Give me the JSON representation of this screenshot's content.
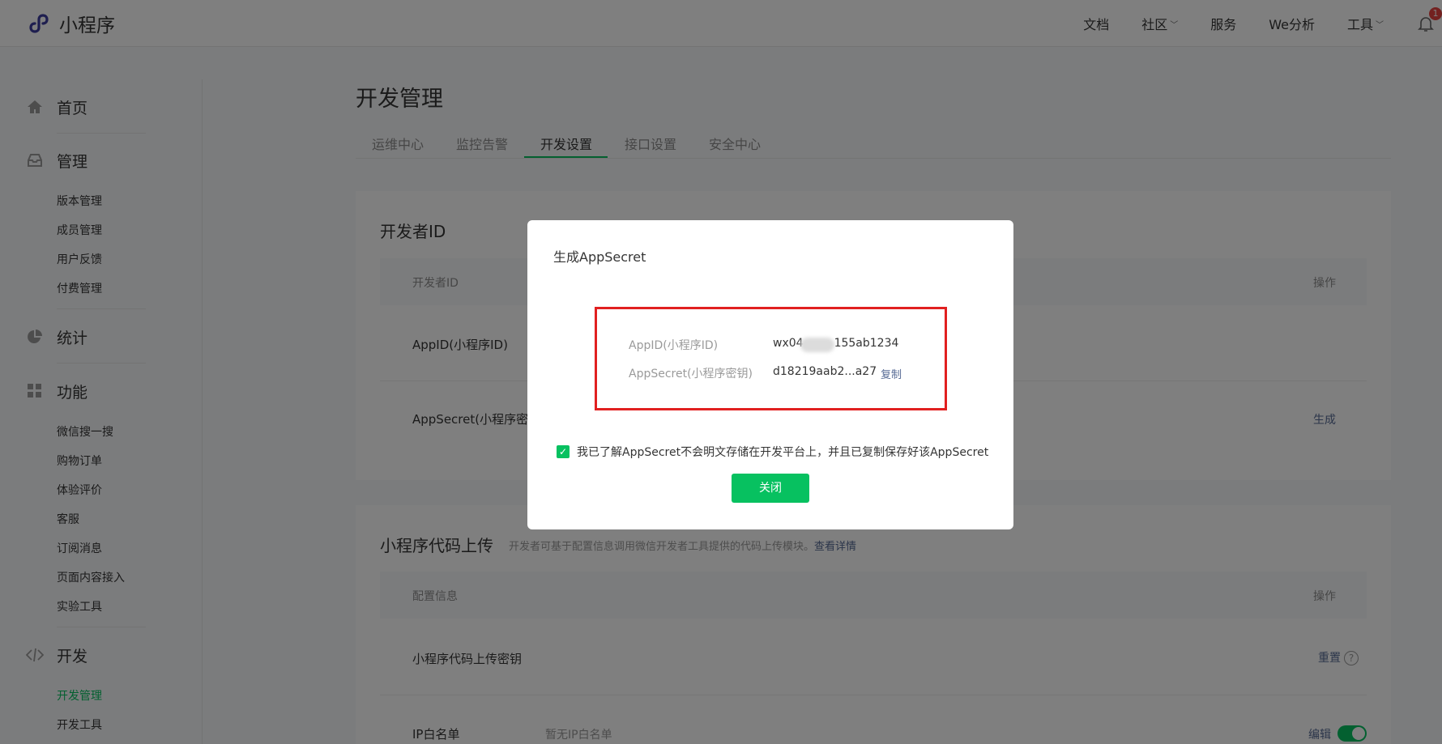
{
  "header": {
    "logo_text": "小程序",
    "nav": [
      {
        "label": "文档",
        "has_dropdown": false
      },
      {
        "label": "社区",
        "has_dropdown": true
      },
      {
        "label": "服务",
        "has_dropdown": false
      },
      {
        "label": "We分析",
        "has_dropdown": false
      },
      {
        "label": "工具",
        "has_dropdown": true
      }
    ],
    "notification_count": "1"
  },
  "sidebar": {
    "groups": [
      {
        "label": "首页",
        "icon": "home-icon",
        "items": []
      },
      {
        "label": "管理",
        "icon": "inbox-icon",
        "items": [
          "版本管理",
          "成员管理",
          "用户反馈",
          "付费管理"
        ]
      },
      {
        "label": "统计",
        "icon": "pie-chart-icon",
        "items": []
      },
      {
        "label": "功能",
        "icon": "grid-icon",
        "items": [
          "微信搜一搜",
          "购物订单",
          "体验评价",
          "客服",
          "订阅消息",
          "页面内容接入",
          "实验工具"
        ]
      },
      {
        "label": "开发",
        "icon": "code-icon",
        "items": [
          "开发管理",
          "开发工具"
        ],
        "active_item": "开发管理"
      }
    ]
  },
  "main": {
    "title": "开发管理",
    "tabs": [
      "运维中心",
      "监控告警",
      "开发设置",
      "接口设置",
      "安全中心"
    ],
    "active_tab": "开发设置",
    "developer_card": {
      "title": "开发者ID",
      "col_id": "开发者ID",
      "col_op": "操作",
      "rows": [
        {
          "label": "AppID(小程序ID)"
        },
        {
          "label": "AppSecret(小程序密钥)",
          "op": "生成"
        }
      ]
    },
    "upload_card": {
      "title": "小程序代码上传",
      "subtitle": "开发者可基于配置信息调用微信开发者工具提供的代码上传模块。",
      "subtitle_link": "查看详情",
      "col_config": "配置信息",
      "col_op": "操作",
      "rows": [
        {
          "label": "小程序代码上传密钥",
          "op": "重置",
          "help": "?"
        },
        {
          "label": "IP白名单",
          "value": "暂无IP白名单",
          "op": "编辑",
          "toggle_on": true
        }
      ]
    }
  },
  "dialog": {
    "title": "生成AppSecret",
    "appid_label": "AppID(小程序ID)",
    "appid_value": "wx04",
    "appid_value_tail": "155ab1234",
    "secret_label": "AppSecret(小程序密钥)",
    "secret_value": "d18219aab2...a27",
    "copy_label": "复制",
    "checkbox_checked": true,
    "checkbox_text": "我已了解AppSecret不会明文存储在开发平台上，并且已复制保存好该AppSecret",
    "close_label": "关闭"
  },
  "colors": {
    "brand_green": "#07c160",
    "link_blue": "#576b95",
    "highlight_red": "#e12020",
    "logo_purple": "#3d3d9e"
  }
}
